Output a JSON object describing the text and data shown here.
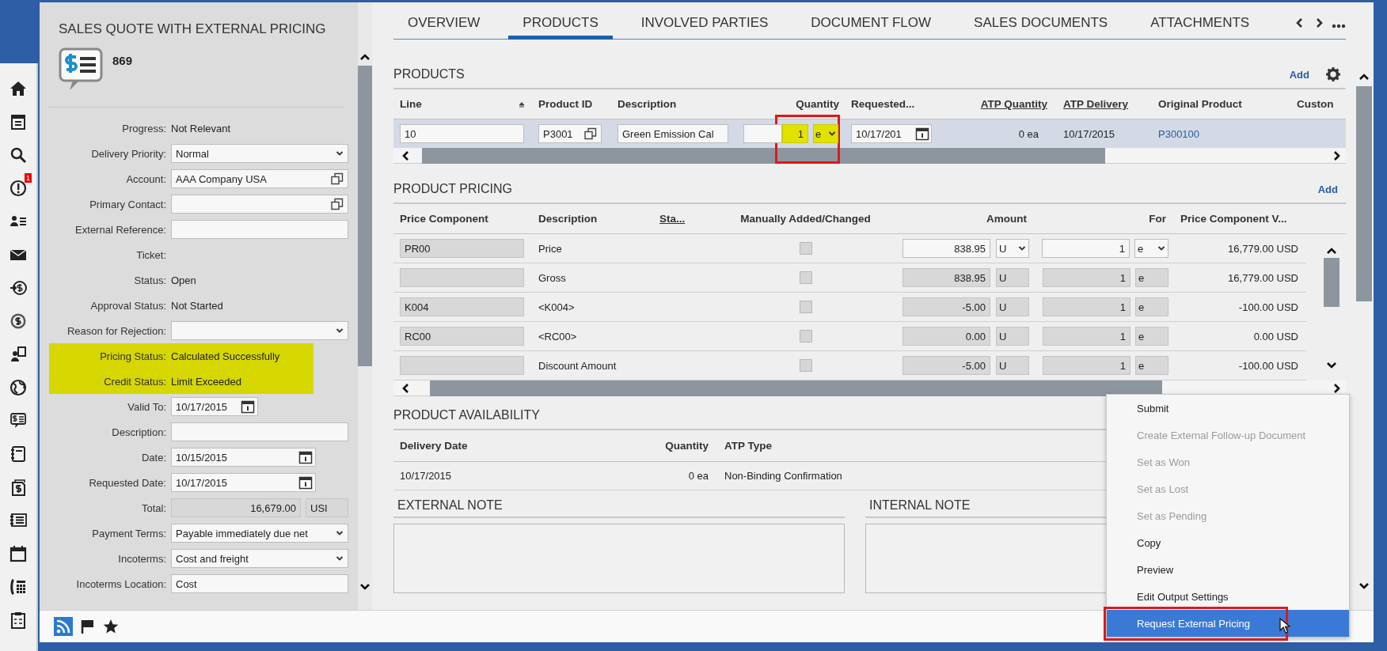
{
  "nav": {
    "badge": "1"
  },
  "header": {
    "title": "SALES QUOTE WITH EXTERNAL PRICING",
    "number": "869"
  },
  "fields": [
    {
      "kind": "text",
      "label": "Progress:",
      "value": "Not Relevant",
      "highlighted": false
    },
    {
      "kind": "select",
      "label": "Delivery Priority:",
      "value": "Normal",
      "highlighted": false
    },
    {
      "kind": "lookup",
      "label": "Account:",
      "value": "AAA Company USA",
      "highlighted": false
    },
    {
      "kind": "lookup",
      "label": "Primary Contact:",
      "highlighted": false
    },
    {
      "kind": "input",
      "label": "External Reference:",
      "highlighted": false
    },
    {
      "kind": "text",
      "label": "Ticket:",
      "highlighted": false
    },
    {
      "kind": "text",
      "label": "Status:",
      "value": "Open",
      "highlighted": false
    },
    {
      "kind": "text",
      "label": "Approval Status:",
      "value": "Not Started",
      "highlighted": false
    },
    {
      "kind": "select",
      "label": "Reason for Rejection:",
      "highlighted": false
    },
    {
      "kind": "text",
      "label": "Pricing Status:",
      "value": "Calculated Successfully",
      "highlighted": true
    },
    {
      "kind": "text",
      "label": "Credit Status:",
      "value": "Limit Exceeded",
      "highlighted": true
    },
    {
      "kind": "short_date",
      "label": "Valid To:",
      "value": "10/17/2015",
      "highlighted": false
    },
    {
      "kind": "input",
      "label": "Description:",
      "highlighted": false
    },
    {
      "kind": "date",
      "label": "Date:",
      "value": "10/15/2015",
      "highlighted": false
    },
    {
      "kind": "date",
      "label": "Requested Date:",
      "value": "10/17/2015",
      "highlighted": false
    },
    {
      "kind": "amount",
      "label": "Total:",
      "value": "16,679.00",
      "currency": "USI",
      "highlighted": false
    },
    {
      "kind": "select",
      "label": "Payment Terms:",
      "value": "Payable immediately due net",
      "highlighted": false
    },
    {
      "kind": "select",
      "label": "Incoterms:",
      "value": "Cost and freight",
      "highlighted": false
    },
    {
      "kind": "input",
      "label": "Incoterms Location:",
      "value": "Cost",
      "highlighted": false
    }
  ],
  "tabs": [
    {
      "label": "OVERVIEW",
      "selected": false
    },
    {
      "label": "PRODUCTS",
      "selected": true
    },
    {
      "label": "INVOLVED PARTIES",
      "selected": false
    },
    {
      "label": "DOCUMENT FLOW",
      "selected": false
    },
    {
      "label": "SALES DOCUMENTS",
      "selected": false
    },
    {
      "label": "ATTACHMENTS",
      "selected": false
    }
  ],
  "products": {
    "title": "PRODUCTS",
    "add": "Add",
    "columns": [
      {
        "label": "Line",
        "sorted": true,
        "underlined": false
      },
      {
        "label": "Product ID",
        "sorted": false,
        "underlined": false
      },
      {
        "label": "Description",
        "sorted": false,
        "underlined": false
      },
      {
        "label": "Quantity",
        "sorted": false,
        "underlined": false
      },
      {
        "label": "Requested...",
        "sorted": false,
        "underlined": false
      },
      {
        "label": "ATP Quantity",
        "sorted": false,
        "underlined": true
      },
      {
        "label": "ATP Delivery",
        "sorted": false,
        "underlined": true
      },
      {
        "label": "Original Product",
        "sorted": false,
        "underlined": false
      },
      {
        "label": "Custon",
        "sorted": false,
        "underlined": false
      }
    ],
    "rows": [
      {
        "selected": true,
        "line": "10",
        "product_id": "P3001",
        "description": "Green Emission Cal",
        "quantity": "1",
        "unit": "e",
        "highlighted": true,
        "requested": "10/17/201",
        "atp_quantity": "0 ea",
        "atp_delivery": "10/17/2015",
        "original_product": "P300100"
      }
    ]
  },
  "pricing": {
    "title": "PRODUCT PRICING",
    "add": "Add",
    "columns": [
      {
        "label": "Price Component",
        "underlined": false
      },
      {
        "label": "Description",
        "underlined": false
      },
      {
        "label": "Sta...",
        "underlined": true
      },
      {
        "label": "Manually Added/Changed",
        "underlined": false
      },
      {
        "label": "Amount",
        "underlined": false
      },
      {
        "label": "For",
        "underlined": false
      },
      {
        "label": "Price Component V...",
        "underlined": false
      }
    ],
    "rows": [
      {
        "editable": true,
        "component": "PR00",
        "description": "Price",
        "checked": false,
        "amount": "838.95",
        "amount_unit": "U",
        "per": "1",
        "per_unit": "e",
        "value": "16,779.00 USD"
      },
      {
        "editable": false,
        "description": "Gross",
        "checked": false,
        "amount": "838.95",
        "amount_unit": "U",
        "per": "1",
        "per_unit": "e",
        "value": "16,779.00 USD"
      },
      {
        "editable": false,
        "component": "K004",
        "description": "<K004>",
        "checked": false,
        "amount": "-5.00",
        "amount_unit": "U",
        "per": "1",
        "per_unit": "e",
        "value": "-100.00 USD"
      },
      {
        "editable": false,
        "component": "RC00",
        "description": "<RC00>",
        "checked": false,
        "amount": "0.00",
        "amount_unit": "U",
        "per": "1",
        "per_unit": "e",
        "value": "0.00 USD"
      },
      {
        "editable": false,
        "description": "Discount Amount",
        "checked": false,
        "amount": "-5.00",
        "amount_unit": "U",
        "per": "1",
        "per_unit": "e",
        "value": "-100.00 USD"
      }
    ]
  },
  "availability": {
    "title": "PRODUCT AVAILABILITY",
    "columns": [
      "Delivery Date",
      "Quantity",
      "ATP Type"
    ],
    "rows": [
      [
        "10/17/2015",
        "0 ea",
        "Non-Binding Confirmation"
      ]
    ]
  },
  "notes": [
    {
      "title": "EXTERNAL NOTE"
    },
    {
      "title": "INTERNAL NOTE"
    }
  ],
  "menu": {
    "items": [
      {
        "label": "Submit",
        "disabled": false,
        "selected": false,
        "highlighted": false
      },
      {
        "label": "Create External Follow-up Document",
        "disabled": true,
        "selected": false,
        "highlighted": false
      },
      {
        "label": "Set as Won",
        "disabled": true,
        "selected": false,
        "highlighted": false
      },
      {
        "label": "Set as Lost",
        "disabled": true,
        "selected": false,
        "highlighted": false
      },
      {
        "label": "Set as Pending",
        "disabled": true,
        "selected": false,
        "highlighted": false
      },
      {
        "label": "Copy",
        "disabled": false,
        "selected": false,
        "highlighted": false
      },
      {
        "label": "Preview",
        "disabled": false,
        "selected": false,
        "highlighted": false
      },
      {
        "label": "Edit Output Settings",
        "disabled": false,
        "selected": false,
        "highlighted": false
      },
      {
        "label": "Request External Pricing",
        "disabled": false,
        "selected": true,
        "highlighted": true
      }
    ]
  }
}
